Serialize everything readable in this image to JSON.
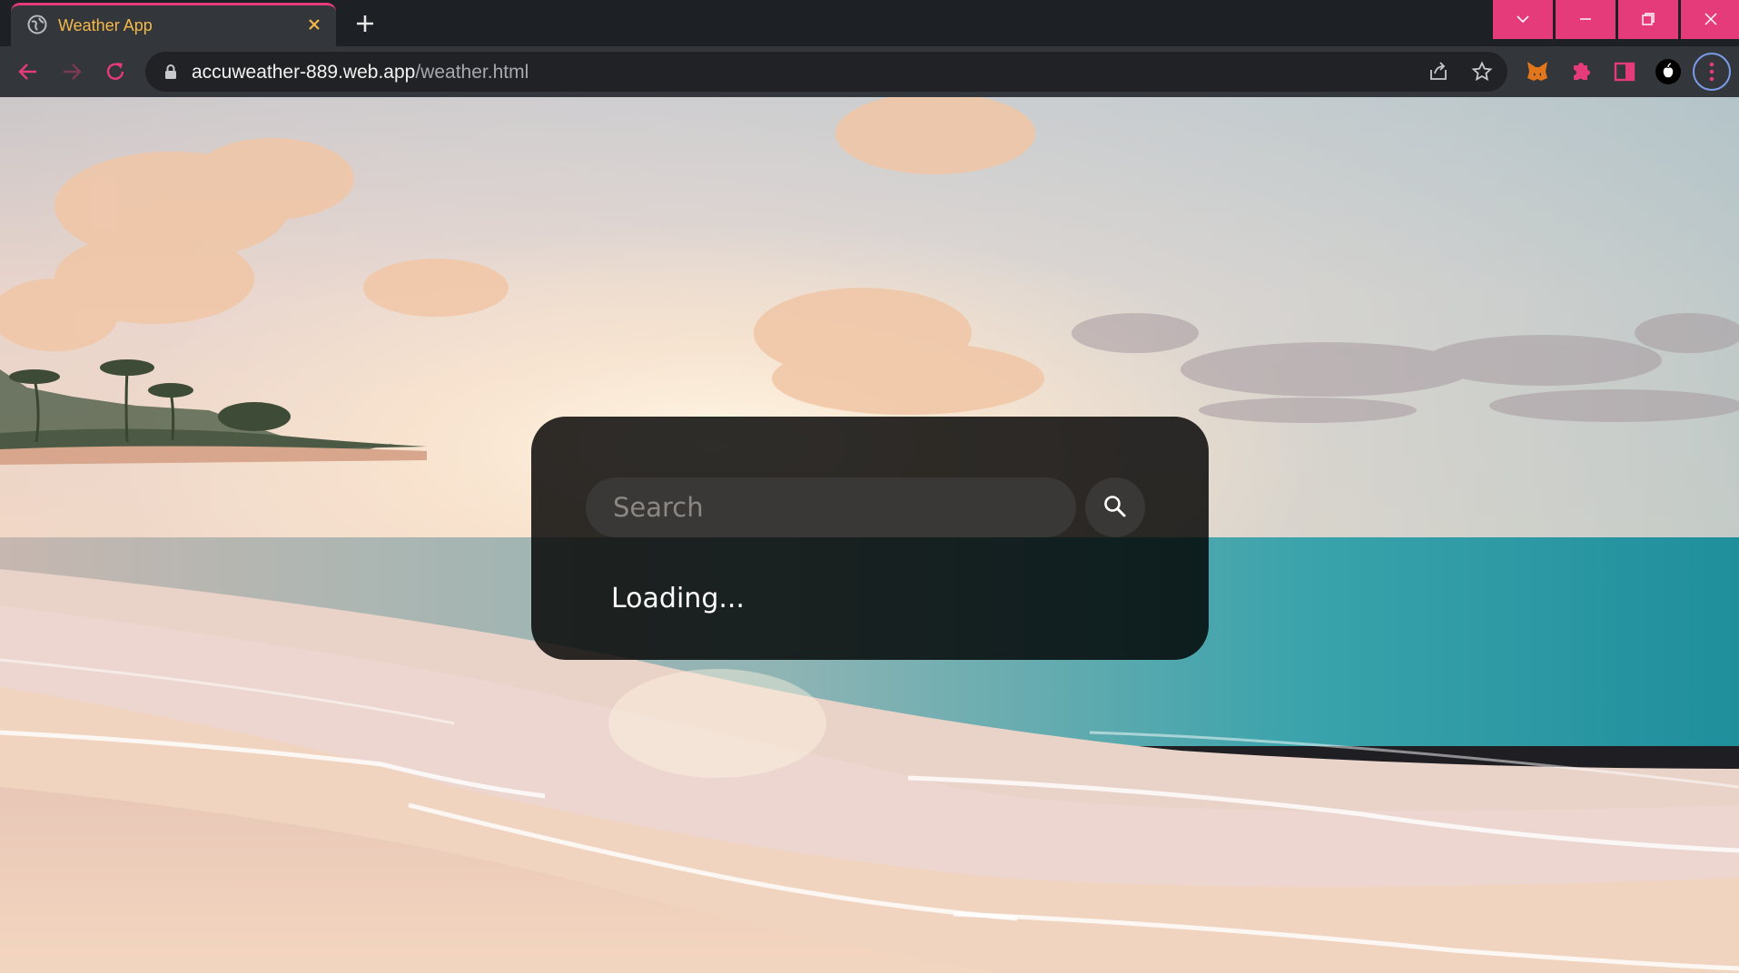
{
  "browser": {
    "tab": {
      "title": "Weather App"
    },
    "address": {
      "host": "accuweather-889.web.app",
      "path": "/weather.html"
    }
  },
  "page": {
    "search": {
      "placeholder": "Search",
      "value": ""
    },
    "status_text": "Loading..."
  },
  "colors": {
    "accent": "#e63b7a",
    "tab_title": "#f5b94a",
    "card_bg": "#000000",
    "input_bg": "#3a3836"
  }
}
